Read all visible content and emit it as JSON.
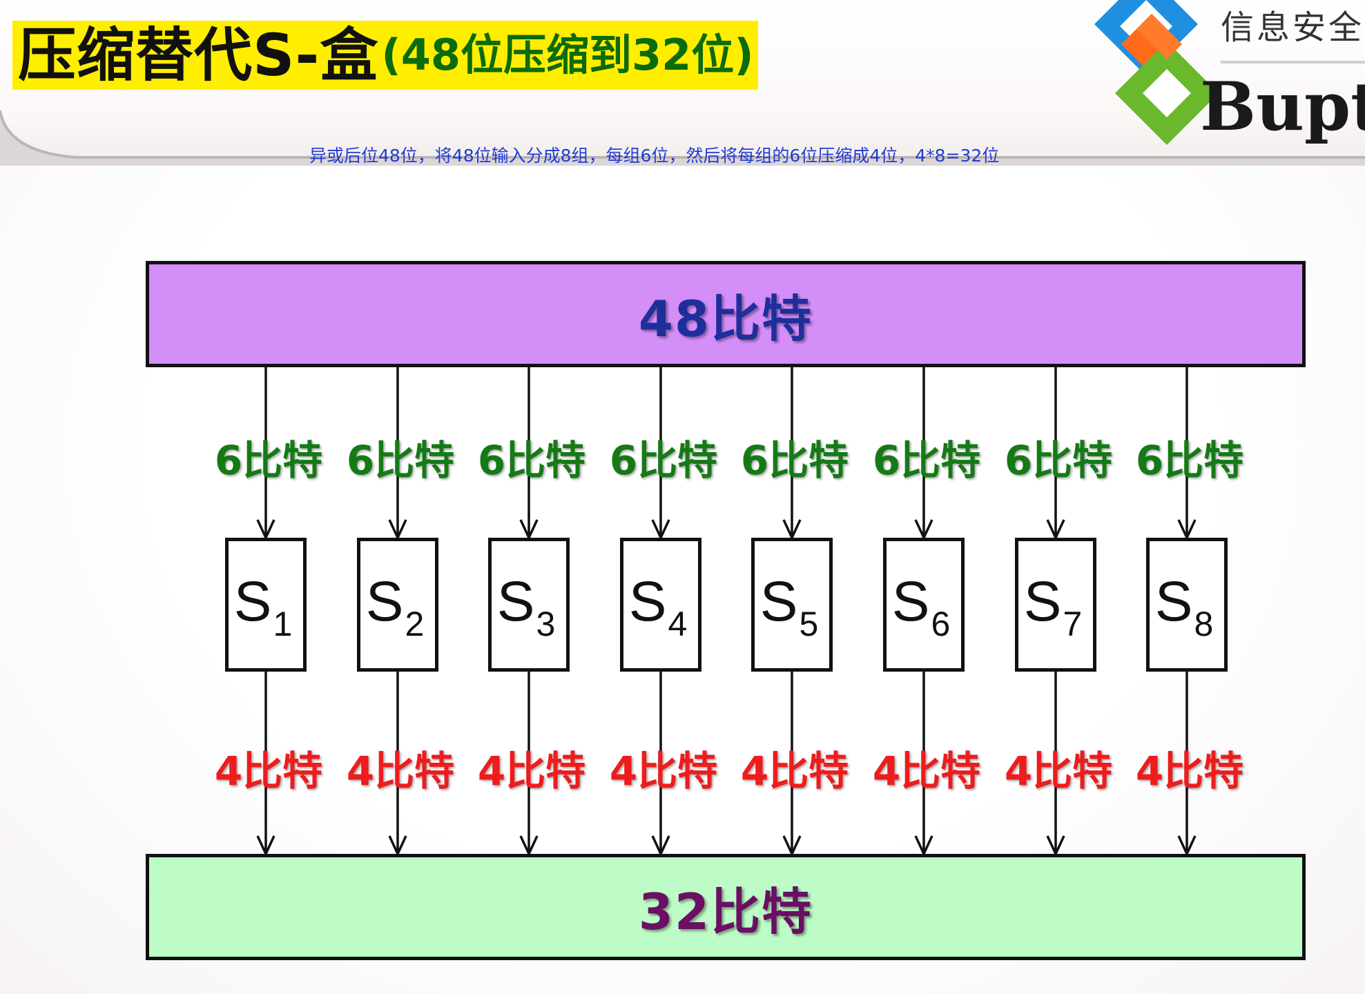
{
  "title": {
    "main": "压缩替代S-盒",
    "sub": "(48位压缩到32位)"
  },
  "note": "异或后位48位，将48位输入分成8组，每组6位，然后将每组的6位压缩成4位，4*8=32位",
  "logo": {
    "cn_text": "信息安全",
    "en_text": "Bupt",
    "colors": [
      "#1f8fe0",
      "#ff6a1a",
      "#6ab82c",
      "#8fd048"
    ]
  },
  "diagram": {
    "input_label": "48比特",
    "output_label": "32比特",
    "group_in_label": "6比特",
    "group_out_label": "4比特",
    "sboxes": [
      {
        "letter": "S",
        "index": "1"
      },
      {
        "letter": "S",
        "index": "2"
      },
      {
        "letter": "S",
        "index": "3"
      },
      {
        "letter": "S",
        "index": "4"
      },
      {
        "letter": "S",
        "index": "5"
      },
      {
        "letter": "S",
        "index": "6"
      },
      {
        "letter": "S",
        "index": "7"
      },
      {
        "letter": "S",
        "index": "8"
      }
    ]
  },
  "colors": {
    "title_highlight": "#ffee00",
    "title_sub": "#0c6b0c",
    "note": "#1f3bd4",
    "input_box": "#d48ef8",
    "output_box": "#bdfcc6",
    "input_text": "#1e2f9c",
    "output_text": "#6a0f63",
    "in_bits": "#157a15",
    "out_bits": "#ee1c1c"
  }
}
